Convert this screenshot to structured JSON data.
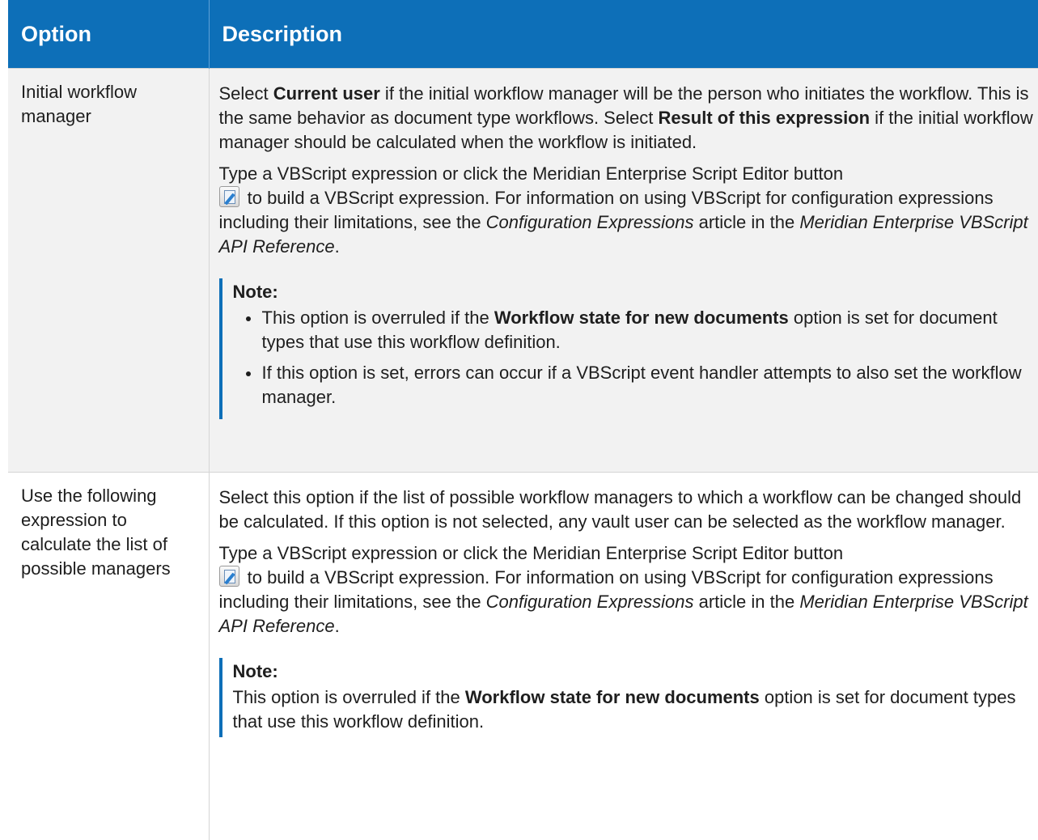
{
  "table": {
    "headers": {
      "option": "Option",
      "description": "Description"
    },
    "rows": [
      {
        "option": "Initial workflow manager",
        "description": {
          "p1": {
            "a": "Select ",
            "b1": "Current user",
            "c": " if the initial workflow manager will be the person who initiates the workflow. This is the same behavior as document type workflows. Select ",
            "b2": "Result of this expression",
            "d": " if the initial workflow manager should be calculated when the workflow is initiated."
          },
          "p2": {
            "a": "Type a VBScript expression or click the Meridian Enterprise Script Editor button",
            "icon": "script-editor-icon",
            "b": " to build a VBScript expression.  For information on using VBScript for configuration expressions including their limitations, see the ",
            "i1": "Configuration Expressions",
            "c": " article in the ",
            "i2": "Meridian Enterprise VBScript API Reference",
            "d": "."
          },
          "note": {
            "label": "Note:",
            "bullet1": {
              "a": "This option is overruled if the ",
              "b": "Workflow state for new documents",
              "c": " option is set for document types that use this workflow definition."
            },
            "bullet2": "If this option is set, errors can occur if a VBScript event handler attempts to also set the workflow manager."
          }
        }
      },
      {
        "option": "Use the following expression to calculate the list of possible managers",
        "description": {
          "p1": "Select this option if the list of possible workflow managers to which a workflow can be changed should be calculated. If this option is not selected, any vault user can be selected as the workflow manager.",
          "p2": {
            "a": "Type a VBScript expression or click the Meridian Enterprise Script Editor button",
            "icon": "script-editor-icon",
            "b": " to build a VBScript expression.  For information on using VBScript for configuration expressions including their limitations, see the ",
            "i1": "Configuration Expressions",
            "c": " article in the ",
            "i2": "Meridian Enterprise VBScript API Reference",
            "d": "."
          },
          "note": {
            "label": "Note:",
            "a": "This option is overruled if the ",
            "b": "Workflow state for new documents",
            "c": " option is set for document types that use this workflow definition."
          }
        }
      }
    ]
  },
  "colors": {
    "header_bg": "#0d6fb8",
    "header_text": "#ffffff",
    "shaded_row": "#f2f2f2",
    "note_bar": "#0d6fb8"
  }
}
